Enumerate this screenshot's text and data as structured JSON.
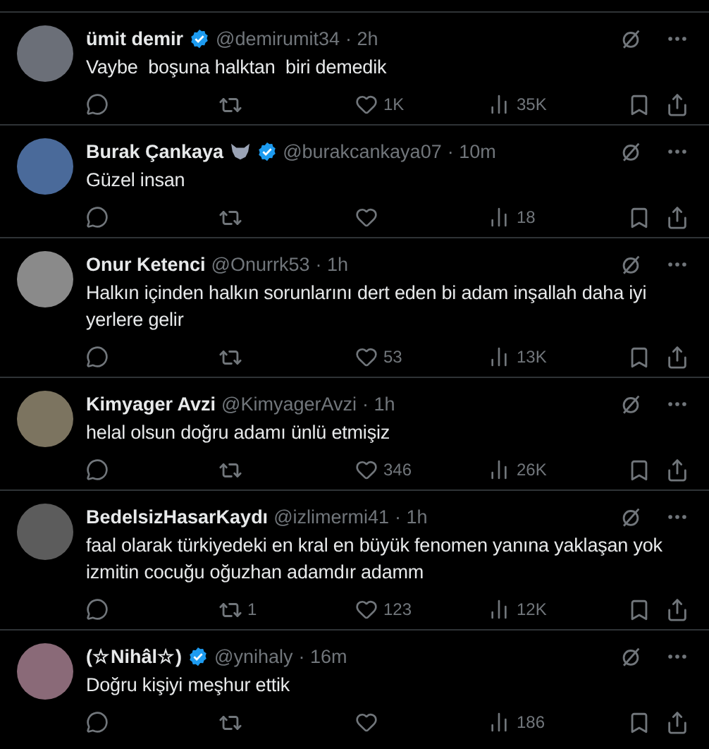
{
  "tweets": [
    {
      "name": "ümit demir",
      "affiliate_badge": false,
      "verified": true,
      "handle": "@demirumit34",
      "time": "· 2h",
      "text": "Vaybe  boşuna halktan  biri demedik",
      "likes": "1K",
      "views": "35K"
    },
    {
      "name": "Burak Çankaya",
      "affiliate_badge": true,
      "verified": true,
      "handle": "@burakcankaya07",
      "time": "· 10m",
      "text": "Güzel insan",
      "views": "18"
    },
    {
      "name": "Onur Ketenci",
      "affiliate_badge": false,
      "verified": false,
      "handle": "@Onurrk53",
      "time": "· 1h",
      "text": "Halkın içinden halkın sorunlarını dert eden bi adam inşallah daha iyi yerlere gelir",
      "likes": "53",
      "views": "13K"
    },
    {
      "name": "Kimyager Avzi",
      "affiliate_badge": false,
      "verified": false,
      "handle": "@KimyagerAvzi",
      "time": "· 1h",
      "text": "helal olsun doğru adamı ünlü etmişiz",
      "likes": "346",
      "views": "26K"
    },
    {
      "name": "BedelsizHasarKaydı",
      "affiliate_badge": false,
      "verified": false,
      "handle": "@izlimermi41",
      "time": "· 1h",
      "text": "faal olarak türkiyedeki en kral en büyük fenomen yanına yaklaşan yok izmitin cocuğu oğuzhan adamdır adamm",
      "retweets": "1",
      "likes": "123",
      "views": "12K"
    },
    {
      "name": "(☆Nihâl☆)",
      "affiliate_badge": false,
      "verified": true,
      "handle": "@ynihaly",
      "time": "· 16m",
      "text": "Doğru kişiyi meşhur ettik",
      "views": "186"
    }
  ]
}
